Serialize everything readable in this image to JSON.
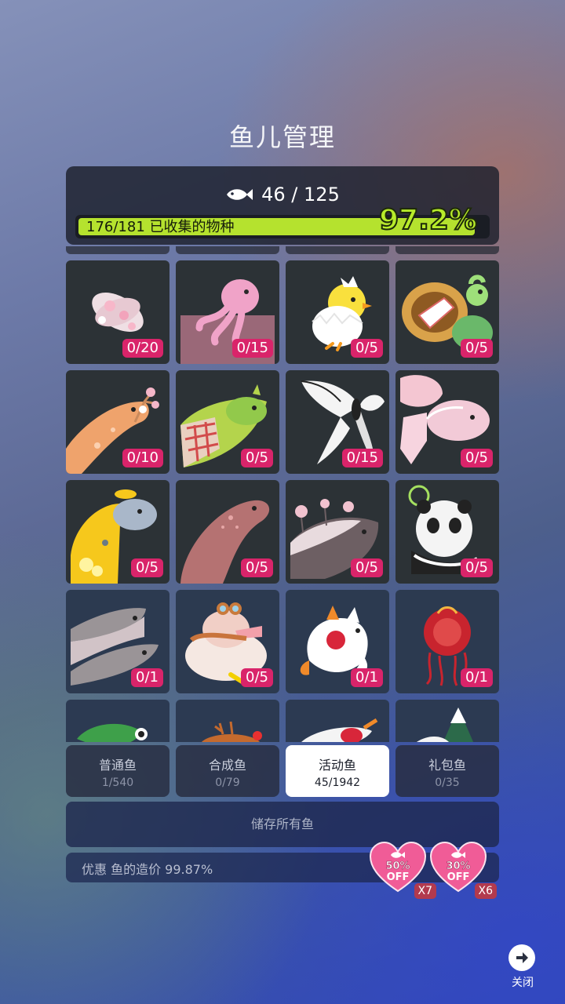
{
  "title": "鱼儿管理",
  "fish_count": "46 / 125",
  "progress": {
    "label": "176/181 已收集的物种",
    "percent_text": "97.2%",
    "fill_fraction": 0.972
  },
  "fish_cells": [
    {
      "name": "sakura-anemone",
      "count": "0/20"
    },
    {
      "name": "pink-squid",
      "count": "0/15"
    },
    {
      "name": "egg-chick",
      "count": "0/5"
    },
    {
      "name": "basket-turtle",
      "count": "0/5"
    },
    {
      "name": "blossom-salamander",
      "count": "0/10"
    },
    {
      "name": "picnic-fish",
      "count": "0/5"
    },
    {
      "name": "white-butterfly",
      "count": "0/15"
    },
    {
      "name": "sakura-axolotl",
      "count": "0/5"
    },
    {
      "name": "yellow-manatee",
      "count": "0/5"
    },
    {
      "name": "spotted-seal",
      "count": "0/5"
    },
    {
      "name": "blossom-whale",
      "count": "0/5"
    },
    {
      "name": "space-panda",
      "count": "0/5"
    },
    {
      "name": "twin-sharks",
      "count": "0/1"
    },
    {
      "name": "aviator-platypus",
      "count": "0/5"
    },
    {
      "name": "lucky-cat-fish",
      "count": "0/1"
    },
    {
      "name": "lantern-jellyfish",
      "count": "0/1"
    },
    {
      "name": "leaf-frog",
      "count": ""
    },
    {
      "name": "reindeer-fish",
      "count": ""
    },
    {
      "name": "koi-fish",
      "count": ""
    },
    {
      "name": "snowy-tree",
      "count": ""
    }
  ],
  "tabs": [
    {
      "label": "普通鱼",
      "count": "1/540",
      "active": false
    },
    {
      "label": "合成鱼",
      "count": "0/79",
      "active": false
    },
    {
      "label": "活动鱼",
      "count": "45/1942",
      "active": true
    },
    {
      "label": "礼包鱼",
      "count": "0/35",
      "active": false
    }
  ],
  "store_all_label": "储存所有鱼",
  "discount_text": "优惠 鱼的造价 99.87%",
  "coupons": [
    {
      "percent": "50%",
      "off": "OFF",
      "multiplier": "X7"
    },
    {
      "percent": "30%",
      "off": "OFF",
      "multiplier": "X6"
    }
  ],
  "close_label": "关闭",
  "colors": {
    "badge": "#d9246a",
    "progress_fill": "#b5e22e",
    "heart": "#f05c97"
  }
}
